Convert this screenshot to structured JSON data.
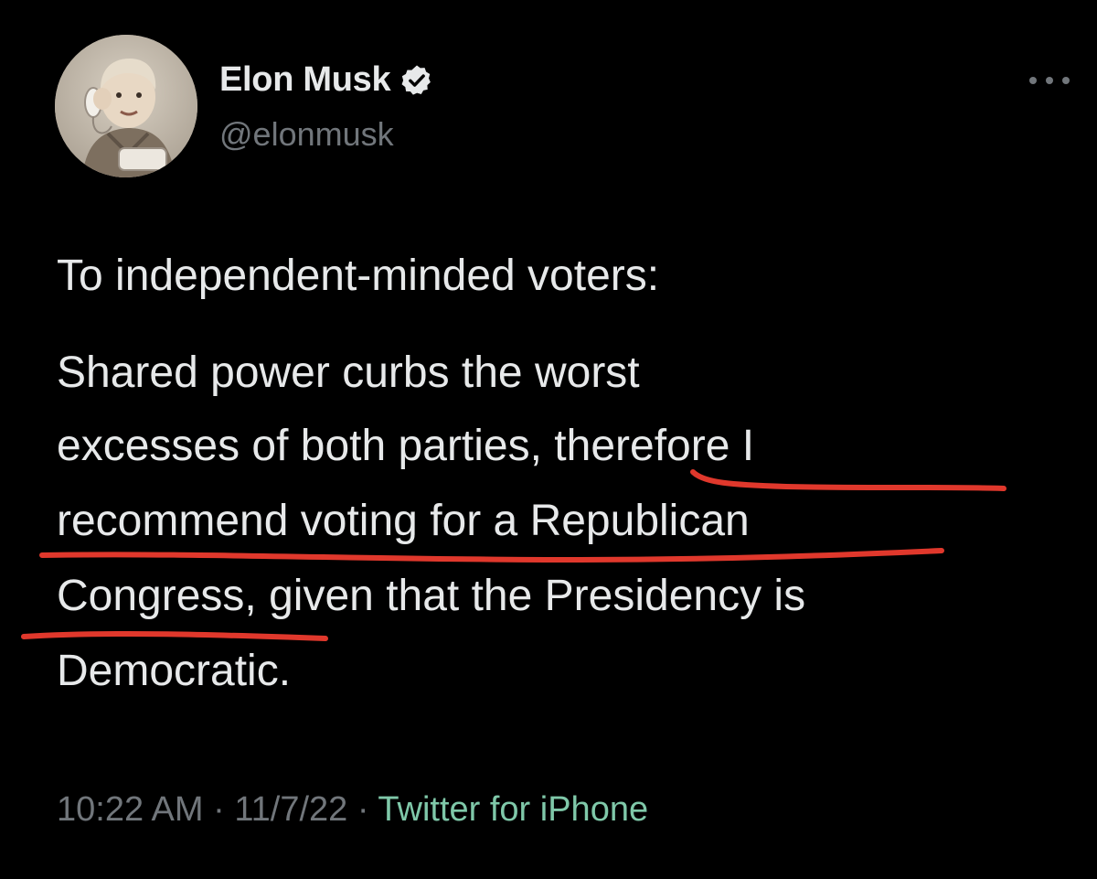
{
  "tweet": {
    "display_name": "Elon Musk",
    "handle": "@elonmusk",
    "text_lines": [
      "To independent-minded voters:",
      "Shared power curbs the worst",
      "excesses of both parties, therefore I",
      "recommend voting for a Republican",
      "Congress, given that the Presidency is",
      "Democratic."
    ],
    "time": "10:22 AM",
    "separator": "·",
    "date": "11/7/22",
    "source": "Twitter for iPhone"
  },
  "icons": {
    "verified": "verified-badge-icon",
    "more": "more-horizontal-icon"
  },
  "colors": {
    "background": "#000000",
    "text": "#e7e9ea",
    "secondary": "#71767b",
    "source_link": "#7fc8a9",
    "annotation_underline": "#e0382c"
  }
}
